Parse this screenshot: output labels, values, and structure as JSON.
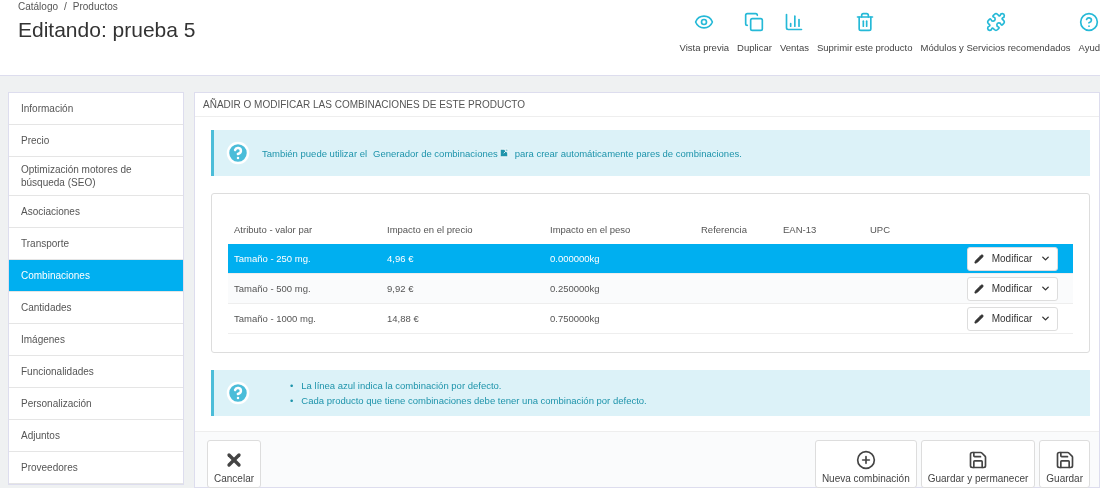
{
  "breadcrumb": [
    "Catálogo",
    "Productos"
  ],
  "breadcrumb_separator": "/",
  "title": "Editando: prueba 5",
  "toolbar": [
    {
      "kind": "eye",
      "label": "Vista previa"
    },
    {
      "kind": "copy",
      "label": "Duplicar"
    },
    {
      "kind": "chart",
      "label": "Ventas"
    },
    {
      "kind": "trash",
      "label": "Suprimir este producto"
    },
    {
      "kind": "puzzle",
      "label": "Módulos y Servicios recomendados"
    },
    {
      "kind": "help",
      "label": "Ayud"
    }
  ],
  "sidebar": {
    "items": [
      {
        "label": "Información",
        "selected": false
      },
      {
        "label": "Precio",
        "selected": false
      },
      {
        "label": "Optimización motores de búsqueda (SEO)",
        "selected": false
      },
      {
        "label": "Asociaciones",
        "selected": false
      },
      {
        "label": "Transporte",
        "selected": false
      },
      {
        "label": "Combinaciones",
        "selected": true
      },
      {
        "label": "Cantidades",
        "selected": false
      },
      {
        "label": "Imágenes",
        "selected": false
      },
      {
        "label": "Funcionalidades",
        "selected": false
      },
      {
        "label": "Personalización",
        "selected": false
      },
      {
        "label": "Adjuntos",
        "selected": false
      },
      {
        "label": "Proveedores",
        "selected": false
      }
    ]
  },
  "panel": {
    "heading": "AÑADIR O MODIFICAR LAS COMBINACIONES DE ESTE PRODUCTO",
    "info": {
      "before": "También puede utilizar el",
      "link": "Generador de combinaciones",
      "after": "para crear automáticamente pares de combinaciones."
    },
    "table": {
      "columns": [
        "Atributo - valor par",
        "Impacto en el precio",
        "Impacto en el peso",
        "Referencia",
        "EAN-13",
        "UPC"
      ],
      "rows": [
        {
          "cells": [
            "Tamaño - 250 mg.",
            "4,96 €",
            "0.000000kg",
            "",
            "",
            ""
          ],
          "selected": true,
          "action": "Modificar"
        },
        {
          "cells": [
            "Tamaño - 500 mg.",
            "9,92 €",
            "0.250000kg",
            "",
            "",
            ""
          ],
          "selected": false,
          "action": "Modificar"
        },
        {
          "cells": [
            "Tamaño - 1000 mg.",
            "14,88 €",
            "0.750000kg",
            "",
            "",
            ""
          ],
          "selected": false,
          "action": "Modificar"
        }
      ]
    },
    "note_bullet": "•",
    "notes": [
      "La línea azul indica la combinación por defecto.",
      "Cada producto que tiene combinaciones debe tener una combinación por defecto."
    ],
    "footer": [
      {
        "kind": "cancel",
        "label": "Cancelar"
      },
      {
        "kind": "add",
        "label": "Nueva combinación"
      },
      {
        "kind": "save",
        "label": "Guardar y permanecer"
      },
      {
        "kind": "save",
        "label": "Guardar"
      }
    ]
  }
}
